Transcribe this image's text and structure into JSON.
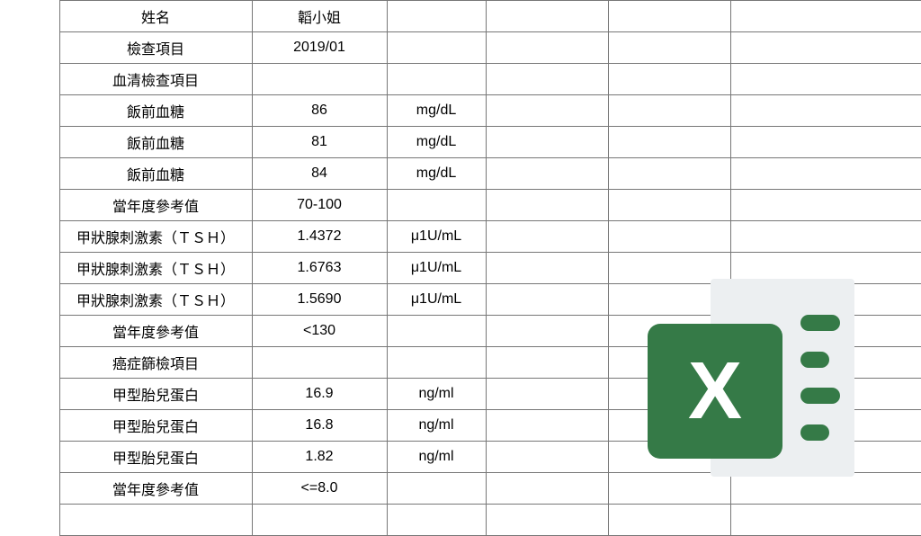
{
  "table": {
    "rows": [
      {
        "b": "姓名",
        "c": "韜小姐",
        "d": "",
        "e": "",
        "f": "",
        "g": ""
      },
      {
        "b": "檢查項目",
        "c": "2019/01",
        "d": "",
        "e": "",
        "f": "",
        "g": ""
      },
      {
        "b": "血清檢查項目",
        "c": "",
        "d": "",
        "e": "",
        "f": "",
        "g": ""
      },
      {
        "b": "飯前血糖",
        "c": "86",
        "d": "mg/dL",
        "e": "",
        "f": "",
        "g": ""
      },
      {
        "b": "飯前血糖",
        "c": "81",
        "d": "mg/dL",
        "e": "",
        "f": "",
        "g": ""
      },
      {
        "b": "飯前血糖",
        "c": "84",
        "d": "mg/dL",
        "e": "",
        "f": "",
        "g": ""
      },
      {
        "b": "當年度參考值",
        "c": "70-100",
        "d": "",
        "e": "",
        "f": "",
        "g": ""
      },
      {
        "b": "甲狀腺刺激素（ＴＳＨ）",
        "c": "1.4372",
        "d": "μ1U/mL",
        "e": "",
        "f": "",
        "g": ""
      },
      {
        "b": "甲狀腺刺激素（ＴＳＨ）",
        "c": "1.6763",
        "d": "μ1U/mL",
        "e": "",
        "f": "",
        "g": ""
      },
      {
        "b": "甲狀腺刺激素（ＴＳＨ）",
        "c": "1.5690",
        "d": "μ1U/mL",
        "e": "",
        "f": "",
        "g": ""
      },
      {
        "b": "當年度參考值",
        "c": "<130",
        "d": "",
        "e": "",
        "f": "",
        "g": ""
      },
      {
        "b": "癌症篩檢項目",
        "c": "",
        "d": "",
        "e": "",
        "f": "",
        "g": ""
      },
      {
        "b": "甲型胎兒蛋白",
        "c": "16.9",
        "d": "ng/ml",
        "e": "",
        "f": "",
        "g": ""
      },
      {
        "b": "甲型胎兒蛋白",
        "c": "16.8",
        "d": "ng/ml",
        "e": "",
        "f": "",
        "g": ""
      },
      {
        "b": "甲型胎兒蛋白",
        "c": "1.82",
        "d": "ng/ml",
        "e": "",
        "f": "",
        "g": ""
      },
      {
        "b": "當年度參考值",
        "c": "<=8.0",
        "d": "",
        "e": "",
        "f": "",
        "g": ""
      },
      {
        "b": "",
        "c": "",
        "d": "",
        "e": "",
        "f": "",
        "g": ""
      }
    ]
  },
  "icon": {
    "letter": "X"
  }
}
